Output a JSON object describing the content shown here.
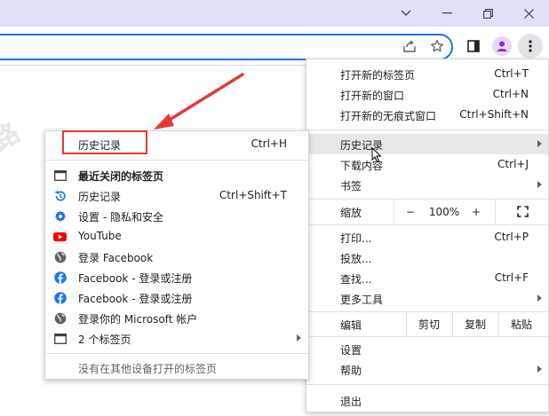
{
  "colors": {
    "accent": "#1a73e8",
    "annotation_red": "#e53935",
    "youtube_red": "#ff0000",
    "facebook_blue": "#1877f2",
    "gear_blue": "#1a73e8",
    "highlight": "#e8e8e8"
  },
  "toolbar": {
    "icons": [
      "share-icon",
      "star-icon",
      "side-panel-icon",
      "profile-icon",
      "kebab-menu-icon"
    ]
  },
  "watermarks": [
    "跨境出海",
    "跨境出海陆路",
    "跨境出海陆路",
    "路",
    "跨境"
  ],
  "main_menu": {
    "new_tab": "打开新的标签页",
    "new_tab_shortcut": "Ctrl+T",
    "new_window": "打开新的窗口",
    "new_window_shortcut": "Ctrl+N",
    "new_incognito": "打开新的无痕式窗口",
    "new_incognito_shortcut": "Ctrl+Shift+N",
    "history": "历史记录",
    "downloads": "下载内容",
    "downloads_shortcut": "Ctrl+J",
    "bookmarks": "书签",
    "zoom": "缩放",
    "zoom_minus": "−",
    "zoom_value": "100%",
    "zoom_plus": "+",
    "print": "打印...",
    "print_shortcut": "Ctrl+P",
    "cast": "投放...",
    "find": "查找...",
    "find_shortcut": "Ctrl+F",
    "more_tools": "更多工具",
    "edit": "编辑",
    "cut": "剪切",
    "copy": "复制",
    "paste": "粘贴",
    "settings": "设置",
    "help": "帮助",
    "exit": "退出"
  },
  "history_menu": {
    "title": "历史记录",
    "title_shortcut": "Ctrl+H",
    "recently_closed": "最近关闭的标签页",
    "items": [
      {
        "label": "历史记录",
        "shortcut": "Ctrl+Shift+T",
        "icon": "history-clock-icon"
      },
      {
        "label": "设置 - 隐私和安全",
        "icon": "gear-icon"
      },
      {
        "label": "YouTube",
        "icon": "youtube-icon"
      },
      {
        "label": "登录 Facebook",
        "icon": "globe-icon"
      },
      {
        "label": "Facebook - 登录或注册",
        "icon": "facebook-icon"
      },
      {
        "label": "Facebook - 登录或注册",
        "icon": "facebook-icon"
      },
      {
        "label": "登录你的 Microsoft 帐户",
        "icon": "globe-icon"
      },
      {
        "label": "2 个标签页",
        "icon": "tab-window-icon"
      }
    ],
    "other_devices": "没有在其他设备打开的标签页"
  }
}
